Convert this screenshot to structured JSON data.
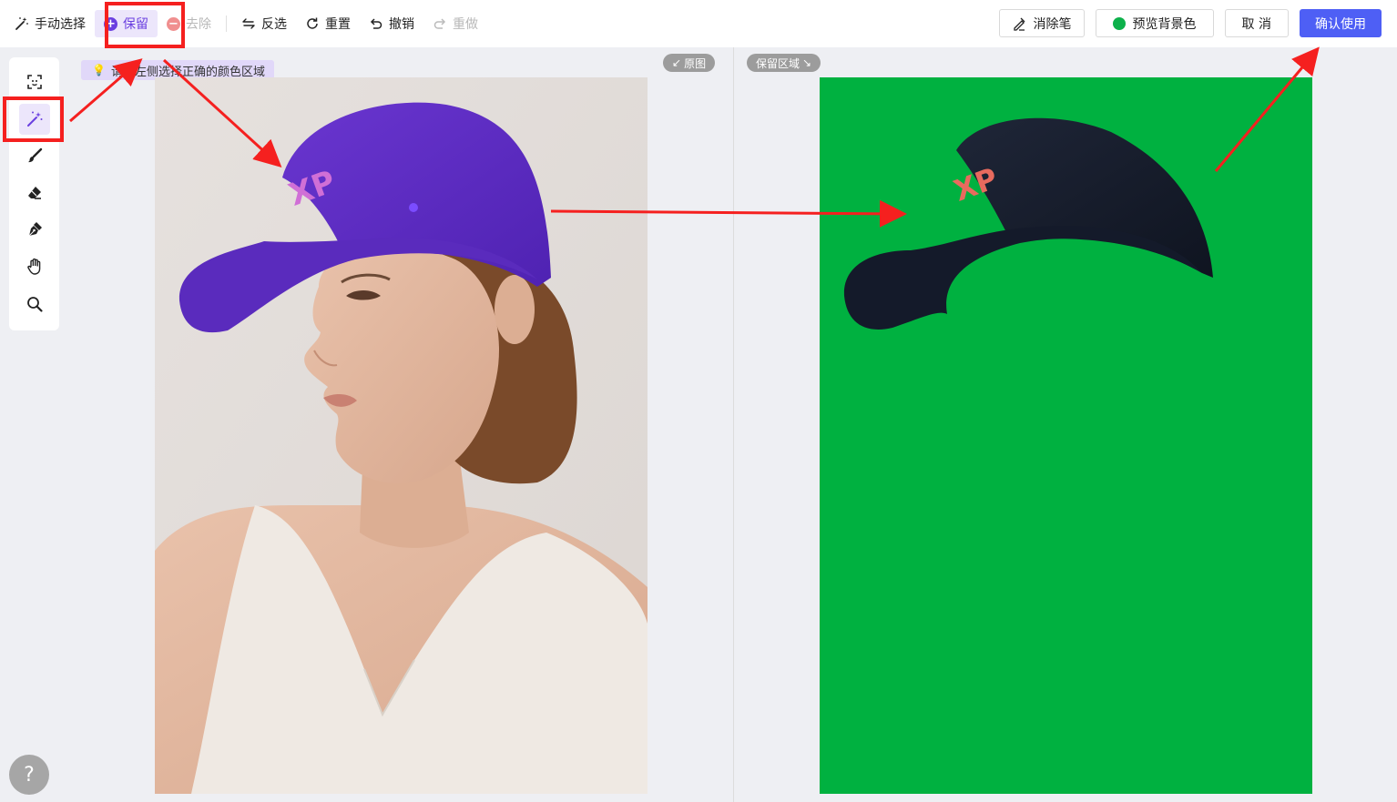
{
  "toolbar": {
    "manual_select": "手动选择",
    "keep": "保留",
    "remove": "去除",
    "invert": "反选",
    "reset": "重置",
    "undo": "撤销",
    "redo": "重做",
    "eraser": "消除笔",
    "preview_bg": "预览背景色",
    "cancel": "取 消",
    "confirm": "确认使用"
  },
  "hint": {
    "text": "请在左侧选择正确的颜色区域"
  },
  "labels": {
    "original": "原图",
    "keep_area": "保留区域"
  },
  "help": "?",
  "colors": {
    "accent": "#6a3fe0",
    "primary_button": "#4e5ff5",
    "preview_background": "#00b140",
    "annotation_red": "#f5201f",
    "cap_original": "#5a2bbd",
    "cap_result": "#141a2a"
  },
  "tools": [
    {
      "name": "smart-select-icon"
    },
    {
      "name": "magic-wand-icon",
      "active": true
    },
    {
      "name": "brush-icon"
    },
    {
      "name": "eraser-icon"
    },
    {
      "name": "pen-icon"
    },
    {
      "name": "hand-icon"
    },
    {
      "name": "zoom-icon"
    }
  ]
}
